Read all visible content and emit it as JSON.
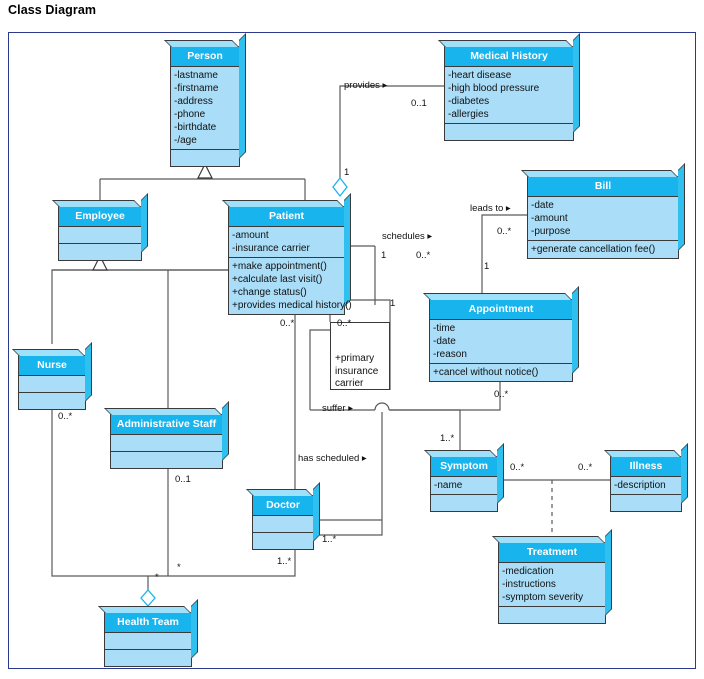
{
  "page": {
    "title": "Class Diagram"
  },
  "classes": [
    {
      "id": "person",
      "name": "Person",
      "attributes": [
        "-lastname",
        "-firstname",
        "-address",
        "-phone",
        "-birthdate",
        "-/age"
      ],
      "operations": []
    },
    {
      "id": "medical_history",
      "name": "Medical History",
      "attributes": [
        "-heart disease",
        "-high blood pressure",
        "-diabetes",
        "-allergies"
      ],
      "operations": []
    },
    {
      "id": "employee",
      "name": "Employee",
      "attributes": [],
      "operations": []
    },
    {
      "id": "patient",
      "name": "Patient",
      "attributes": [
        "-amount",
        "-insurance carrier"
      ],
      "operations": [
        "+make appointment()",
        "+calculate last visit()",
        "+change status()",
        "+provides medical history()"
      ]
    },
    {
      "id": "bill",
      "name": "Bill",
      "attributes": [
        "-date",
        "-amount",
        "-purpose"
      ],
      "operations": [
        "+generate cancellation fee()"
      ]
    },
    {
      "id": "appointment",
      "name": "Appointment",
      "attributes": [
        "-time",
        "-date",
        "-reason"
      ],
      "operations": [
        "+cancel without notice()"
      ]
    },
    {
      "id": "nurse",
      "name": "Nurse",
      "attributes": [],
      "operations": []
    },
    {
      "id": "administrative_staff",
      "name": "Administrative Staff",
      "attributes": [],
      "operations": []
    },
    {
      "id": "doctor",
      "name": "Doctor",
      "attributes": [],
      "operations": []
    },
    {
      "id": "symptom",
      "name": "Symptom",
      "attributes": [
        "-name"
      ],
      "operations": []
    },
    {
      "id": "illness",
      "name": "Illness",
      "attributes": [
        "-description"
      ],
      "operations": []
    },
    {
      "id": "treatment",
      "name": "Treatment",
      "attributes": [
        "-medication",
        "-instructions",
        "-symptom severity"
      ],
      "operations": []
    },
    {
      "id": "health_team",
      "name": "Health Team",
      "attributes": [],
      "operations": []
    }
  ],
  "association_note": {
    "multiplicity_left": "0..*",
    "multiplicity_right": "0..*",
    "multiplicity_top": "1",
    "lines": [
      "+primary",
      "insurance",
      "carrier"
    ]
  },
  "edge_labels": {
    "provides": "provides ▸",
    "schedules": "schedules ▸",
    "leads_to": "leads to ▸",
    "suffer": "suffer ▸",
    "has_scheduled": "has scheduled ▸"
  },
  "multiplicities": {
    "mh_patient_mh_end": "0..1",
    "mh_patient_patient_end": "1",
    "patient_appt_patient_end": "1",
    "patient_appt_appt_end": "0..*",
    "appt_bill_bill_end": "0..*",
    "appt_bill_appt_end": "1",
    "appt_symptom_appt_end": "0..*",
    "appt_symptom_symptom_end": "1..*",
    "symptom_illness_symptom_end": "0..*",
    "symptom_illness_illness_end": "0..*",
    "nurse_team": "0..*",
    "admin_team": "0..1",
    "doctor_team_star": "1..*",
    "doctor_symptom": "1..*",
    "team_star_mid": "*",
    "team_star_low": "*"
  },
  "colors": {
    "header_fill": "#18b4ee",
    "body_fill": "#a9ddf8",
    "depth_fill": "#2fc0f0",
    "border": "#3a3a3a",
    "frame": "#2b3a8f",
    "line": "#5a5a5a",
    "diamond_stroke": "#18b4ee"
  }
}
